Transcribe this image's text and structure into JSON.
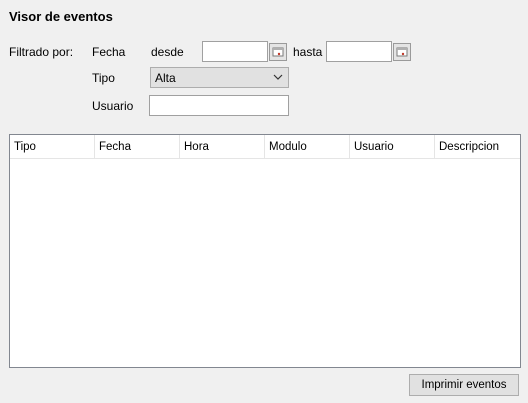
{
  "window": {
    "title": "Visor de eventos"
  },
  "filter": {
    "label": "Filtrado por:",
    "fecha_label": "Fecha",
    "desde_label": "desde",
    "desde_value": "",
    "hasta_label": "hasta",
    "hasta_value": "",
    "tipo_label": "Tipo",
    "tipo_value": "Alta",
    "usuario_label": "Usuario",
    "usuario_value": ""
  },
  "table": {
    "columns": [
      "Tipo",
      "Fecha",
      "Hora",
      "Modulo",
      "Usuario",
      "Descripcion"
    ],
    "rows": []
  },
  "actions": {
    "print_label": "Imprimir eventos"
  },
  "icons": {
    "calendar": "calendar-icon",
    "dropdown": "chevron-down-icon"
  }
}
